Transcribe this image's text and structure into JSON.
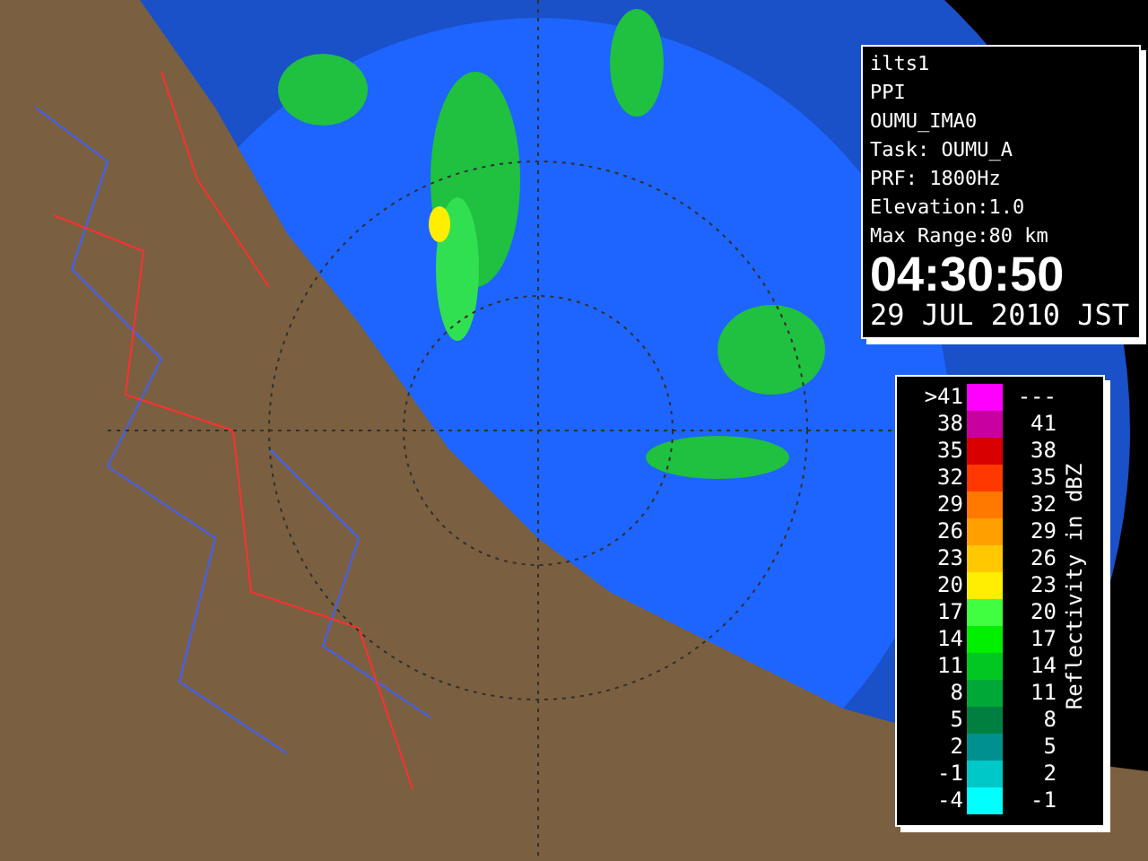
{
  "info_panel": {
    "lines": [
      "ilts1",
      "PPI",
      "OUMU_IMA0",
      "Task: OUMU_A",
      "PRF: 1800Hz",
      "Elevation:1.0",
      "Max Range:80 km"
    ],
    "time": "04:30:50",
    "date": "29 JUL 2010 JST"
  },
  "legend": {
    "title": "Reflectivity in dBZ",
    "rows": [
      {
        "low": ">41",
        "high": "---",
        "color": "#ff00ff"
      },
      {
        "low": "38",
        "high": "41",
        "color": "#c800a0"
      },
      {
        "low": "35",
        "high": "38",
        "color": "#d80000"
      },
      {
        "low": "32",
        "high": "35",
        "color": "#ff3800"
      },
      {
        "low": "29",
        "high": "32",
        "color": "#ff7800"
      },
      {
        "low": "26",
        "high": "29",
        "color": "#ffa000"
      },
      {
        "low": "23",
        "high": "26",
        "color": "#ffc800"
      },
      {
        "low": "20",
        "high": "23",
        "color": "#ffee00"
      },
      {
        "low": "17",
        "high": "20",
        "color": "#40ff40"
      },
      {
        "low": "14",
        "high": "17",
        "color": "#00f000"
      },
      {
        "low": "11",
        "high": "14",
        "color": "#00c820"
      },
      {
        "low": "8",
        "high": "11",
        "color": "#00a838"
      },
      {
        "low": "5",
        "high": "8",
        "color": "#008040"
      },
      {
        "low": "2",
        "high": "5",
        "color": "#009090"
      },
      {
        "low": "-1",
        "high": "2",
        "color": "#00c8c8"
      },
      {
        "low": "-4",
        "high": "-1",
        "color": "#00ffff"
      }
    ]
  }
}
